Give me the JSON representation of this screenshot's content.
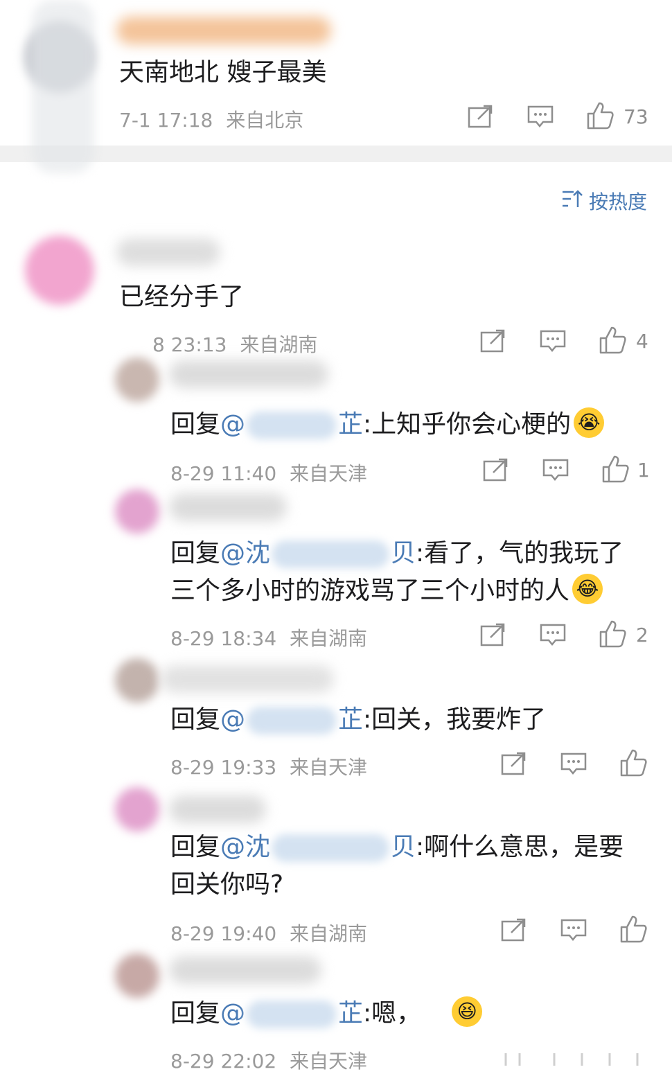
{
  "top_comment": {
    "text": "天南地北 嫂子最美",
    "time": "7-1 17:18",
    "location": "来自北京",
    "likes": "73"
  },
  "sort": {
    "label": "按热度",
    "icon": "sort-icon"
  },
  "comment": {
    "text": "已经分手了",
    "time_partial": "8 23:13",
    "location": "来自湖南",
    "likes": "4"
  },
  "replies": [
    {
      "prefix": "回复",
      "mention_start": "@",
      "mention_end": "芷",
      "text": ":上知乎你会心梗的",
      "emoji": "crying-face",
      "time": "8-29 11:40",
      "location": "来自天津",
      "likes": "1"
    },
    {
      "prefix": "回复",
      "mention_start": "@沈",
      "mention_end": "贝",
      "text": ":看了，气的我玩了",
      "text_line2": "三个多小时的游戏骂了三个小时的人",
      "emoji": "laughing-crying-face",
      "time": "8-29 18:34",
      "location": "来自湖南",
      "likes": "2"
    },
    {
      "prefix": "回复",
      "mention_start": "@",
      "mention_end": "芷",
      "text": ":回关，我要炸了",
      "time": "8-29 19:33",
      "location": "来自天津",
      "likes": ""
    },
    {
      "prefix": "回复",
      "mention_start": "@沈",
      "mention_end": "贝",
      "text": ":啊什么意思，是要",
      "text_line2": "回关你吗?",
      "time": "8-29 19:40",
      "location": "来自湖南",
      "likes": ""
    },
    {
      "prefix": "回复",
      "mention_start": "@",
      "mention_end": "芷",
      "text": ":嗯，",
      "emoji": "grinning-face",
      "time": "8-29 22:02",
      "location": "来自天津",
      "likes": ""
    }
  ],
  "colors": {
    "link": "#4a7bb5",
    "meta": "#9a9a9a",
    "divider": "#f0f0f0"
  }
}
